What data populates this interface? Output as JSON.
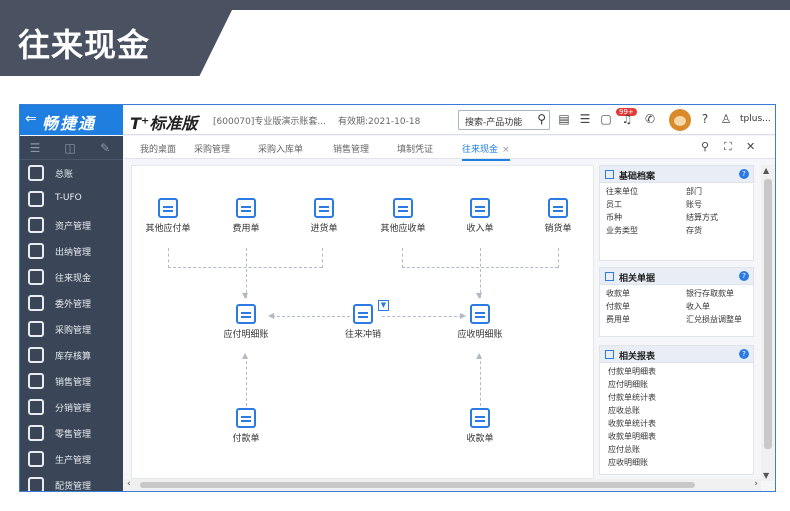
{
  "slide": {
    "title": "往来现金"
  },
  "app": {
    "brand": "畅捷通",
    "edition": "T⁺标准版",
    "account": "[600070]专业版演示账套...",
    "period": "有效期:2021-10-18",
    "search_placeholder": "搜索-产品功能",
    "notify_badge": "99+",
    "user": "tplus..."
  },
  "sidebar": {
    "items": [
      {
        "label": "总账"
      },
      {
        "label": "T-UFO"
      },
      {
        "label": "资产管理"
      },
      {
        "label": "出纳管理"
      },
      {
        "label": "往来现金"
      },
      {
        "label": "委外管理"
      },
      {
        "label": "采购管理"
      },
      {
        "label": "库存核算"
      },
      {
        "label": "销售管理"
      },
      {
        "label": "分销管理"
      },
      {
        "label": "零售管理"
      },
      {
        "label": "生产管理"
      },
      {
        "label": "配货管理"
      }
    ]
  },
  "tabs": [
    {
      "label": "我的桌面"
    },
    {
      "label": "采购管理"
    },
    {
      "label": "采购入库单"
    },
    {
      "label": "销售管理"
    },
    {
      "label": "填制凭证"
    },
    {
      "label": "往来现金"
    }
  ],
  "flow": {
    "top": [
      {
        "label": "其他应付单"
      },
      {
        "label": "费用单"
      },
      {
        "label": "进货单"
      },
      {
        "label": "其他应收单"
      },
      {
        "label": "收入单"
      },
      {
        "label": "销货单"
      }
    ],
    "middle": [
      {
        "label": "应付明细账"
      },
      {
        "label": "往来冲销"
      },
      {
        "label": "应收明细账"
      }
    ],
    "bottom": [
      {
        "label": "付款单"
      },
      {
        "label": "收款单"
      }
    ]
  },
  "panels": {
    "basic": {
      "title": "基础档案",
      "items": [
        "往来单位",
        "部门",
        "员工",
        "账号",
        "币种",
        "结算方式",
        "业务类型",
        "存货"
      ]
    },
    "docs": {
      "title": "相关单据",
      "items": [
        "收款单",
        "银行存取款单",
        "付款单",
        "收入单",
        "费用单",
        "汇兑损益调整单"
      ]
    },
    "reports": {
      "title": "相关报表",
      "items": [
        "付款单明细表",
        "应付明细账",
        "付款单统计表",
        "应收总账",
        "收款单统计表",
        "收款单明细表",
        "应付总账",
        "应收明细账"
      ]
    }
  },
  "colors": {
    "brand": "#1e7fe0",
    "sidebar": "#3a4557",
    "header": "#4a5262"
  }
}
